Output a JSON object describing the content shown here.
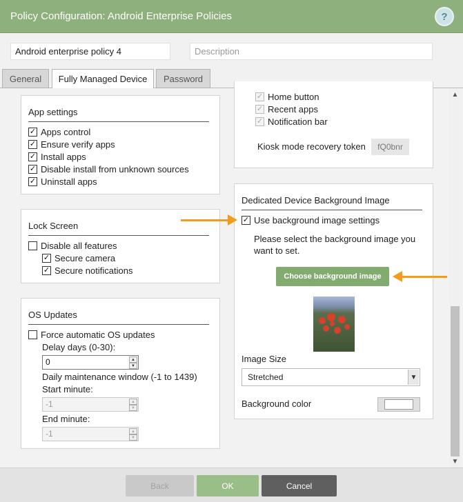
{
  "window": {
    "title": "Policy Configuration: Android Enterprise Policies",
    "help_label": "?"
  },
  "policy": {
    "name_value": "Android enterprise policy 4",
    "description_placeholder": "Description"
  },
  "tabs": [
    {
      "label": "General",
      "active": false
    },
    {
      "label": "Fully Managed Device",
      "active": true
    },
    {
      "label": "Password",
      "active": false
    }
  ],
  "app_settings": {
    "title": "App settings",
    "items": [
      {
        "label": "Apps control",
        "checked": true
      },
      {
        "label": "Ensure verify apps",
        "checked": true
      },
      {
        "label": "Install apps",
        "checked": true
      },
      {
        "label": "Disable install from unknown sources",
        "checked": true
      },
      {
        "label": "Uninstall apps",
        "checked": true
      }
    ]
  },
  "lock_screen": {
    "title": "Lock Screen",
    "disable_all": {
      "label": "Disable all features",
      "checked": false
    },
    "items": [
      {
        "label": "Secure camera",
        "checked": true
      },
      {
        "label": "Secure notifications",
        "checked": true
      }
    ]
  },
  "os_updates": {
    "title": "OS Updates",
    "force": {
      "label": "Force automatic OS updates",
      "checked": false
    },
    "delay_label": "Delay days (0-30):",
    "delay_value": "0",
    "window_label": "Daily maintenance window (-1 to 1439)",
    "start_label": "Start minute:",
    "start_value": "-1",
    "end_label": "End minute:",
    "end_value": "-1"
  },
  "kiosk": {
    "items": [
      {
        "label": "Home button",
        "checked": true
      },
      {
        "label": "Recent apps",
        "checked": true
      },
      {
        "label": "Notification bar",
        "checked": true
      }
    ],
    "token_label": "Kiosk mode recovery token",
    "token_value": "fQ0bnr"
  },
  "background": {
    "title": "Dedicated Device Background Image",
    "use_settings": {
      "label": "Use background image settings",
      "checked": true
    },
    "instruction": "Please select the background image you want to set.",
    "choose_button": "Choose background image",
    "image_size_label": "Image Size",
    "image_size_value": "Stretched",
    "bg_color_label": "Background color",
    "bg_color_value": "#ffffff"
  },
  "footer": {
    "back": "Back",
    "ok": "OK",
    "cancel": "Cancel"
  },
  "colors": {
    "header_green": "#8db07c",
    "button_green": "#82ab70",
    "cancel_gray": "#5f5f5f",
    "annotation_orange": "#f29b1d"
  }
}
